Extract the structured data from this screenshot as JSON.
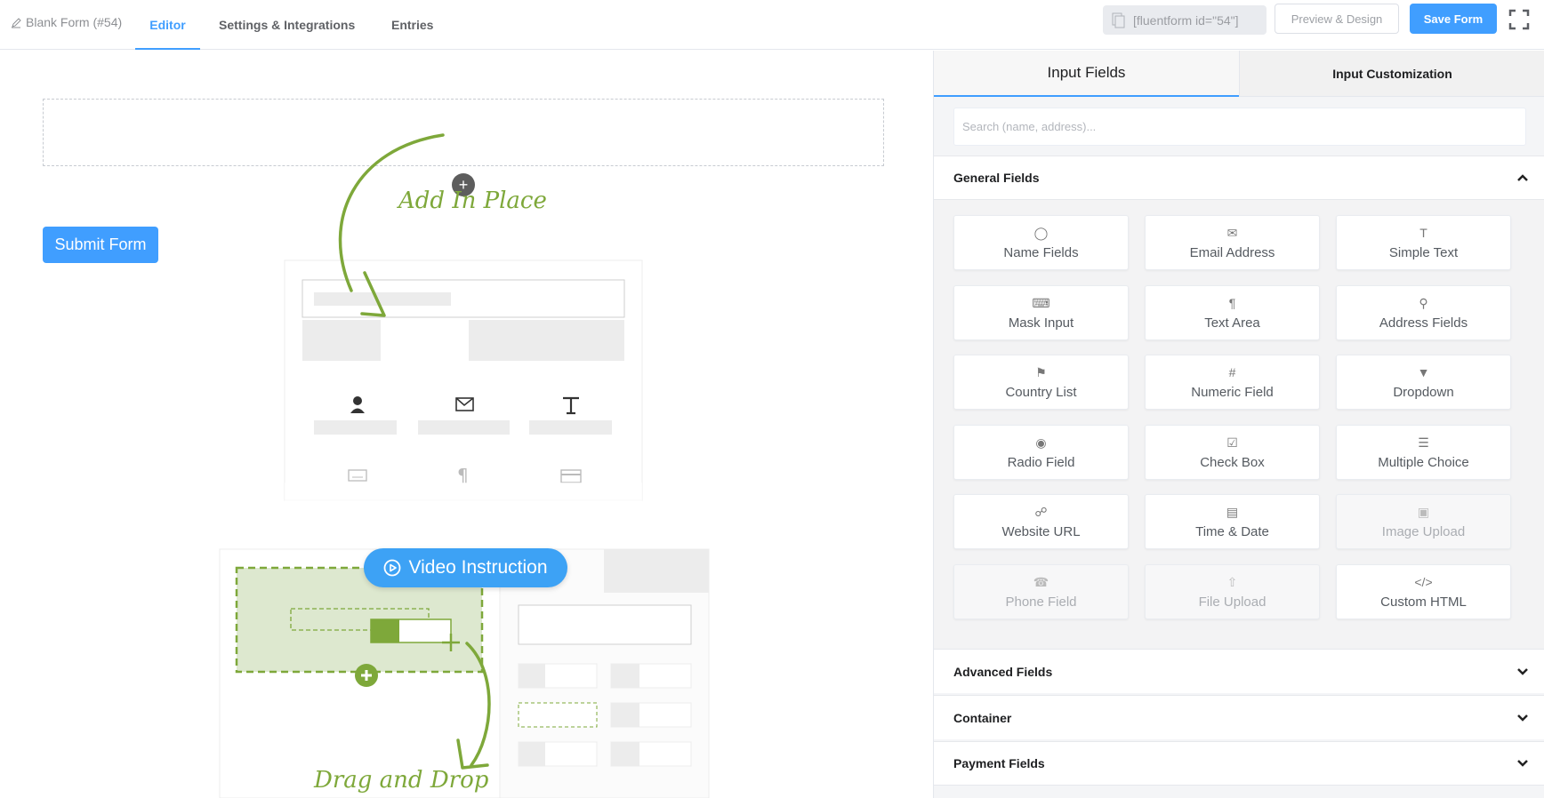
{
  "topbar": {
    "breadcrumb": "Blank Form (#54)",
    "tabs": [
      {
        "label": "Editor",
        "active": true
      },
      {
        "label": "Settings & Integrations",
        "active": false
      },
      {
        "label": "Entries",
        "active": false
      }
    ],
    "shortcode": "[fluentform id=\"54\"]",
    "preview_label": "Preview & Design",
    "save_label": "Save Form",
    "accent": "#409eff"
  },
  "editor": {
    "submit_label": "Submit Form",
    "video_label": "Video Instruction",
    "hint_add": "Add In Place",
    "hint_drag": "Drag and Drop",
    "hint_color": "#7ea83a"
  },
  "panel": {
    "tabs": [
      {
        "label": "Input Fields",
        "active": true
      },
      {
        "label": "Input Customization",
        "active": false
      }
    ],
    "search_placeholder": "Search (name, address)...",
    "general_title": "General Fields",
    "fields": [
      {
        "label": "Name Fields",
        "icon": "user-icon",
        "disabled": false
      },
      {
        "label": "Email Address",
        "icon": "envelope-icon",
        "disabled": false
      },
      {
        "label": "Simple Text",
        "icon": "text-icon",
        "disabled": false
      },
      {
        "label": "Mask Input",
        "icon": "keyboard-icon",
        "disabled": false
      },
      {
        "label": "Text Area",
        "icon": "paragraph-icon",
        "disabled": false
      },
      {
        "label": "Address Fields",
        "icon": "pin-icon",
        "disabled": false
      },
      {
        "label": "Country List",
        "icon": "flag-icon",
        "disabled": false
      },
      {
        "label": "Numeric Field",
        "icon": "hash-icon",
        "disabled": false
      },
      {
        "label": "Dropdown",
        "icon": "dropdown-icon",
        "disabled": false
      },
      {
        "label": "Radio Field",
        "icon": "radio-icon",
        "disabled": false
      },
      {
        "label": "Check Box",
        "icon": "checkbox-icon",
        "disabled": false
      },
      {
        "label": "Multiple Choice",
        "icon": "list-icon",
        "disabled": false
      },
      {
        "label": "Website URL",
        "icon": "link-icon",
        "disabled": false
      },
      {
        "label": "Time & Date",
        "icon": "calendar-icon",
        "disabled": false
      },
      {
        "label": "Image Upload",
        "icon": "image-icon",
        "disabled": true
      },
      {
        "label": "Phone Field",
        "icon": "phone-icon",
        "disabled": true
      },
      {
        "label": "File Upload",
        "icon": "upload-icon",
        "disabled": true
      },
      {
        "label": "Custom HTML",
        "icon": "code-icon",
        "disabled": false
      }
    ],
    "sections": [
      {
        "title": "Advanced Fields"
      },
      {
        "title": "Container"
      },
      {
        "title": "Payment Fields"
      }
    ]
  }
}
